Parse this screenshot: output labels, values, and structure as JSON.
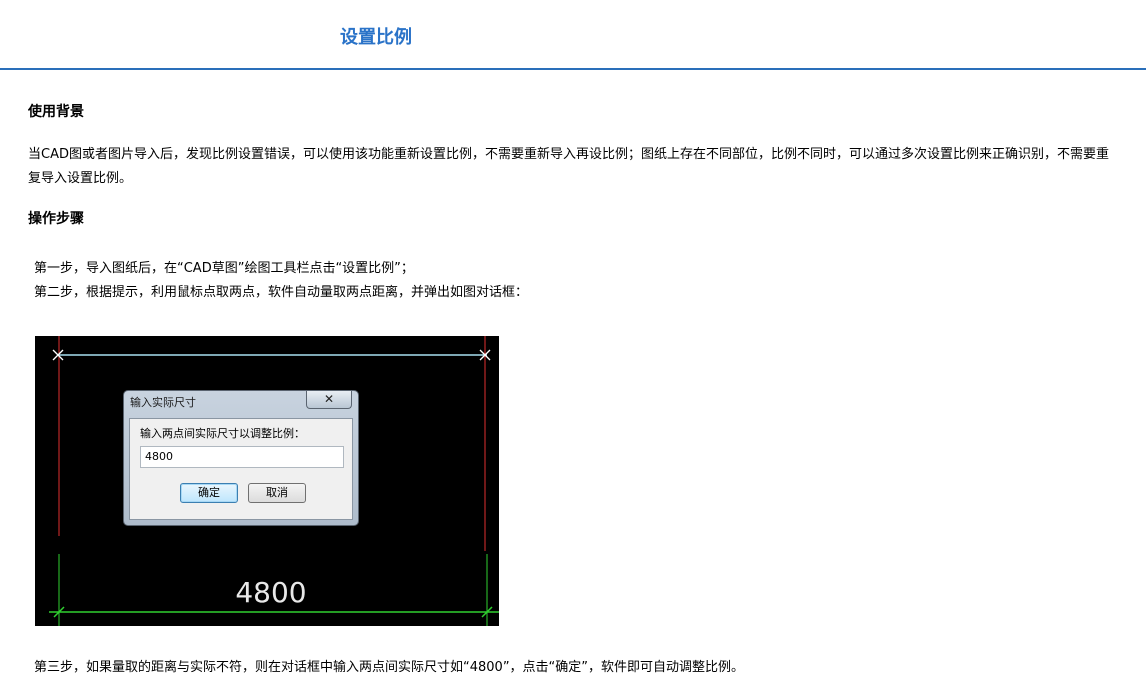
{
  "header": {
    "title": "设置比例"
  },
  "section1": {
    "heading": "使用背景",
    "text": "当CAD图或者图片导入后，发现比例设置错误，可以使用该功能重新设置比例，不需要重新导入再设比例；图纸上存在不同部位，比例不同时，可以通过多次设置比例来正确识别，不需要重复导入设置比例。"
  },
  "section2": {
    "heading": "操作步骤",
    "step1": "第一步，导入图纸后，在“CAD草图”绘图工具栏点击“设置比例”；",
    "step2": "第二步，根据提示，利用鼠标点取两点，软件自动量取两点距离，并弹出如图对话框：",
    "step3": "第三步，如果量取的距离与实际不符，则在对话框中输入两点间实际尺寸如“4800”，点击“确定”，软件即可自动调整比例。"
  },
  "cad_screenshot": {
    "dimension_text": "4800",
    "dialog": {
      "title": "输入实际尺寸",
      "close_label": "✕",
      "prompt": "输入两点间实际尺寸以调整比例：",
      "input_value": "4800",
      "ok_label": "确定",
      "cancel_label": "取消"
    },
    "colors": {
      "background": "#000000",
      "measure_line": "#a8e0f0",
      "boundary": "#e03030",
      "dimension": "#30d030"
    }
  }
}
